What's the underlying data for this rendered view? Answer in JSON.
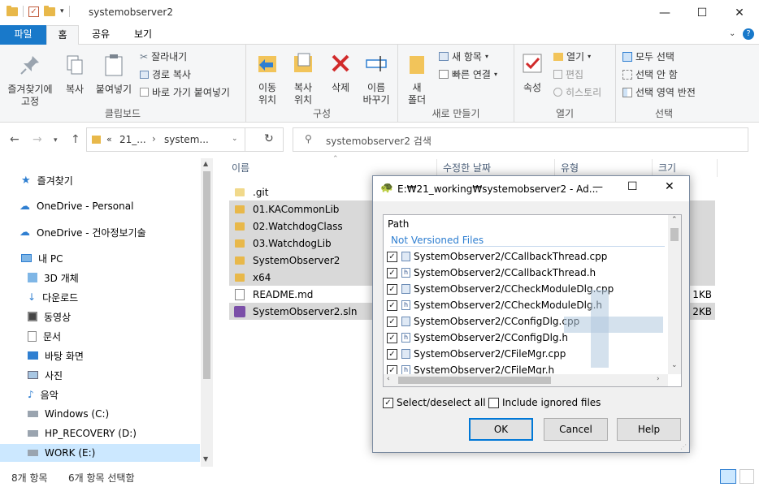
{
  "window": {
    "title": "systemobserver2",
    "minimize": "—",
    "maximize": "☐",
    "close": "✕"
  },
  "ribbon": {
    "tabs": [
      {
        "label": "파일"
      },
      {
        "label": "홈"
      },
      {
        "label": "공유"
      },
      {
        "label": "보기"
      }
    ],
    "clipboard": {
      "pin_label": "즐겨찾기에\n고정",
      "copy_label": "복사",
      "paste_label": "붙여넣기",
      "cut_label": "잘라내기",
      "copy_path_label": "경로 복사",
      "paste_shortcut_label": "바로 가기 붙여넣기",
      "group_label": "클립보드"
    },
    "organize": {
      "move_label": "이동\n위치",
      "copyto_label": "복사\n위치",
      "delete_label": "삭제",
      "rename_label": "이름\n바꾸기",
      "group_label": "구성"
    },
    "new": {
      "new_folder_label": "새\n폴더",
      "new_item_label": "새 항목",
      "easy_access_label": "빠른 연결",
      "group_label": "새로 만들기"
    },
    "open": {
      "properties_label": "속성",
      "open_label": "열기",
      "edit_label": "편집",
      "history_label": "히스토리",
      "group_label": "열기"
    },
    "select": {
      "select_all_label": "모두 선택",
      "select_none_label": "선택 안 함",
      "invert_label": "선택 영역 반전",
      "group_label": "선택"
    }
  },
  "address": {
    "crumb1": "21_...",
    "crumb2": "system...",
    "search_placeholder": "systemobserver2 검색"
  },
  "sidebar": {
    "items": [
      {
        "label": "즐겨찾기"
      },
      {
        "label": "OneDrive - Personal"
      },
      {
        "label": "OneDrive - 건아정보기술"
      },
      {
        "label": "내 PC"
      },
      {
        "label": "3D 개체"
      },
      {
        "label": "다운로드"
      },
      {
        "label": "동영상"
      },
      {
        "label": "문서"
      },
      {
        "label": "바탕 화면"
      },
      {
        "label": "사진"
      },
      {
        "label": "음악"
      },
      {
        "label": "Windows (C:)"
      },
      {
        "label": "HP_RECOVERY (D:)"
      },
      {
        "label": "WORK (E:)"
      }
    ]
  },
  "filelist": {
    "headers": {
      "name": "이름",
      "modified": "수정한 날짜",
      "type": "유형",
      "size": "크기"
    },
    "rows": [
      {
        "name": ".git",
        "size": ""
      },
      {
        "name": "01.KACommonLib",
        "size": ""
      },
      {
        "name": "02.WatchdogClass",
        "size": ""
      },
      {
        "name": "03.WatchdogLib",
        "size": ""
      },
      {
        "name": "SystemObserver2",
        "size": ""
      },
      {
        "name": "x64",
        "size": ""
      },
      {
        "name": "README.md",
        "size": "1KB"
      },
      {
        "name": "SystemObserver2.sln",
        "size": "2KB"
      }
    ]
  },
  "status": {
    "count": "8개 항목",
    "selected": "6개 항목 선택함"
  },
  "dialog": {
    "title": "E:₩21_working₩systemobserver2 - Ad...",
    "list_header": "Path",
    "group_label": "Not Versioned Files",
    "files": [
      {
        "path": "SystemObserver2/CCallbackThread.cpp",
        "kind": "cpp"
      },
      {
        "path": "SystemObserver2/CCallbackThread.h",
        "kind": "h"
      },
      {
        "path": "SystemObserver2/CCheckModuleDlg.cpp",
        "kind": "cpp"
      },
      {
        "path": "SystemObserver2/CCheckModuleDlg.h",
        "kind": "h"
      },
      {
        "path": "SystemObserver2/CConfigDlg.cpp",
        "kind": "cpp"
      },
      {
        "path": "SystemObserver2/CConfigDlg.h",
        "kind": "h"
      },
      {
        "path": "SystemObserver2/CFileMgr.cpp",
        "kind": "cpp"
      },
      {
        "path": "SystemObserver2/CFileMgr.h",
        "kind": "h"
      }
    ],
    "select_all_label": "Select/deselect all",
    "include_ignored_label": "Include ignored files",
    "ok_label": "OK",
    "cancel_label": "Cancel",
    "help_label": "Help"
  },
  "colors": {
    "accent": "#1979ca",
    "selection": "#cce8ff",
    "folder": "#e8b84a"
  }
}
